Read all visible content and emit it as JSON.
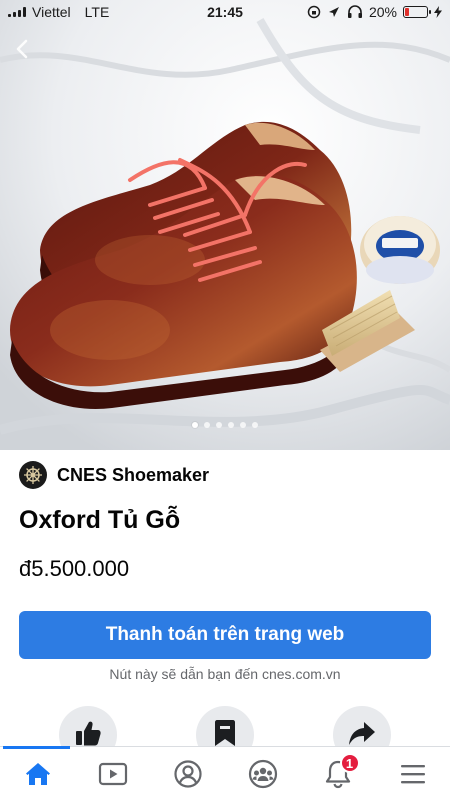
{
  "status_bar": {
    "carrier": "Viettel",
    "network": "LTE",
    "time": "21:45",
    "battery_text": "20%",
    "battery_level": 0.2
  },
  "hero": {
    "image_count": 6,
    "active_index": 0,
    "back_icon": "chevron-left-icon"
  },
  "seller": {
    "name": "CNES Shoemaker"
  },
  "product": {
    "title": "Oxford Tủ Gỗ",
    "price": "đ5.500.000"
  },
  "cta": {
    "label": "Thanh toán trên trang web",
    "hint": "Nút này sẽ dẫn bạn đến cnes.com.vn"
  },
  "actions": [
    {
      "icon": "thumbs-up-icon"
    },
    {
      "icon": "bookmark-icon"
    },
    {
      "icon": "share-icon"
    }
  ],
  "nav": {
    "items": [
      {
        "icon": "home-icon",
        "active": true
      },
      {
        "icon": "video-icon"
      },
      {
        "icon": "profile-icon"
      },
      {
        "icon": "groups-icon"
      },
      {
        "icon": "notifications-icon",
        "badge": "1"
      },
      {
        "icon": "menu-icon"
      }
    ]
  },
  "colors": {
    "primary": "#2d7ce3",
    "nav_active": "#1877f2",
    "badge": "#e41e3f",
    "battery_low": "#e0302c"
  }
}
